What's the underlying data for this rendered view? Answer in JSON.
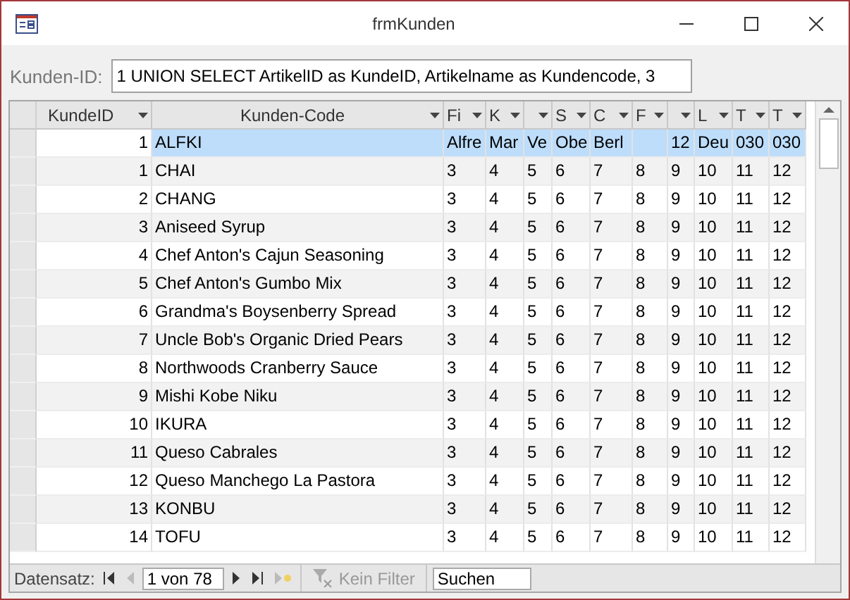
{
  "window": {
    "title": "frmKunden"
  },
  "filter": {
    "label": "Kunden-ID:",
    "value": "1 UNION SELECT ArtikelID as KundeID, Artikelname as Kundencode, 3"
  },
  "table": {
    "columns": [
      {
        "label": "KundeID"
      },
      {
        "label": "Kunden-Code"
      },
      {
        "label": "Fi"
      },
      {
        "label": "K"
      },
      {},
      {
        "label": "S"
      },
      {
        "label": "C"
      },
      {
        "label": "F"
      },
      {},
      {
        "label": "L"
      },
      {
        "label": "T"
      },
      {
        "label": "T"
      }
    ],
    "rows": [
      {
        "selected": true,
        "cells": [
          "1",
          "ALFKI",
          "Alfre",
          "Mar",
          "Ve",
          "Obe",
          "Berl",
          null,
          "12",
          "Deu",
          "030",
          "030"
        ]
      },
      {
        "selected": false,
        "cells": [
          "1",
          "CHAI",
          "3",
          "4",
          "5",
          "6",
          "7",
          "8",
          "9",
          "10",
          "11",
          "12"
        ]
      },
      {
        "selected": false,
        "cells": [
          "2",
          "CHANG",
          "3",
          "4",
          "5",
          "6",
          "7",
          "8",
          "9",
          "10",
          "11",
          "12"
        ]
      },
      {
        "selected": false,
        "cells": [
          "3",
          "Aniseed Syrup",
          "3",
          "4",
          "5",
          "6",
          "7",
          "8",
          "9",
          "10",
          "11",
          "12"
        ]
      },
      {
        "selected": false,
        "cells": [
          "4",
          "Chef Anton's Cajun Seasoning",
          "3",
          "4",
          "5",
          "6",
          "7",
          "8",
          "9",
          "10",
          "11",
          "12"
        ]
      },
      {
        "selected": false,
        "cells": [
          "5",
          "Chef Anton's Gumbo Mix",
          "3",
          "4",
          "5",
          "6",
          "7",
          "8",
          "9",
          "10",
          "11",
          "12"
        ]
      },
      {
        "selected": false,
        "cells": [
          "6",
          "Grandma's Boysenberry Spread",
          "3",
          "4",
          "5",
          "6",
          "7",
          "8",
          "9",
          "10",
          "11",
          "12"
        ]
      },
      {
        "selected": false,
        "cells": [
          "7",
          "Uncle Bob's Organic Dried Pears",
          "3",
          "4",
          "5",
          "6",
          "7",
          "8",
          "9",
          "10",
          "11",
          "12"
        ]
      },
      {
        "selected": false,
        "cells": [
          "8",
          "Northwoods Cranberry Sauce",
          "3",
          "4",
          "5",
          "6",
          "7",
          "8",
          "9",
          "10",
          "11",
          "12"
        ]
      },
      {
        "selected": false,
        "cells": [
          "9",
          "Mishi Kobe Niku",
          "3",
          "4",
          "5",
          "6",
          "7",
          "8",
          "9",
          "10",
          "11",
          "12"
        ]
      },
      {
        "selected": false,
        "cells": [
          "10",
          "IKURA",
          "3",
          "4",
          "5",
          "6",
          "7",
          "8",
          "9",
          "10",
          "11",
          "12"
        ]
      },
      {
        "selected": false,
        "cells": [
          "11",
          "Queso Cabrales",
          "3",
          "4",
          "5",
          "6",
          "7",
          "8",
          "9",
          "10",
          "11",
          "12"
        ]
      },
      {
        "selected": false,
        "cells": [
          "12",
          "Queso Manchego La Pastora",
          "3",
          "4",
          "5",
          "6",
          "7",
          "8",
          "9",
          "10",
          "11",
          "12"
        ]
      },
      {
        "selected": false,
        "cells": [
          "13",
          "KONBU",
          "3",
          "4",
          "5",
          "6",
          "7",
          "8",
          "9",
          "10",
          "11",
          "12"
        ]
      },
      {
        "selected": false,
        "cells": [
          "14",
          "TOFU",
          "3",
          "4",
          "5",
          "6",
          "7",
          "8",
          "9",
          "10",
          "11",
          "12"
        ]
      }
    ]
  },
  "navigation": {
    "label": "Datensatz:",
    "position": "1 von 78",
    "filter": "Kein Filter",
    "search": "Suchen"
  }
}
